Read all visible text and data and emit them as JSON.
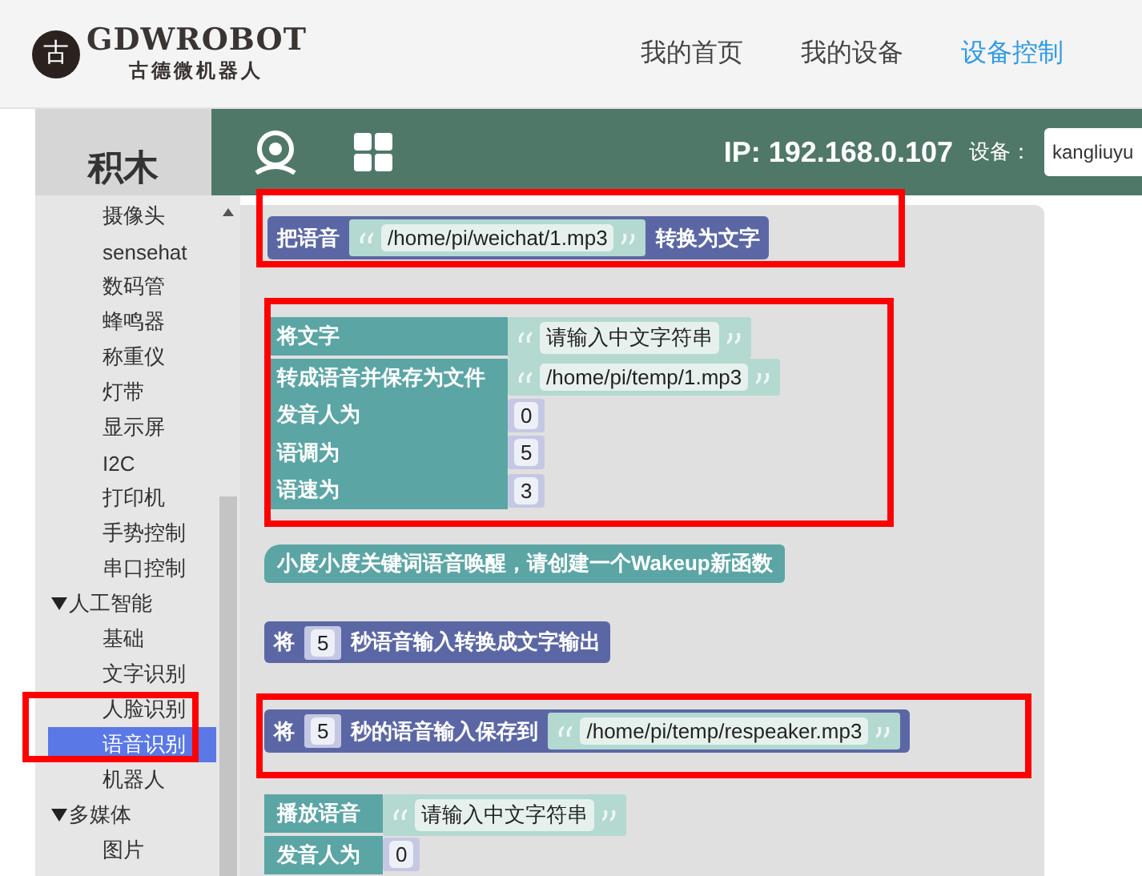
{
  "header": {
    "logo": {
      "mark": "古",
      "title": "GDWROBOT",
      "subtitle": "古德微机器人"
    },
    "nav": [
      {
        "label": "我的首页",
        "selected": false
      },
      {
        "label": "我的设备",
        "selected": false
      },
      {
        "label": "设备控制",
        "selected": true
      }
    ]
  },
  "sidebar": {
    "title": "积木",
    "items": [
      {
        "label": "摄像头",
        "selected": false
      },
      {
        "label": "sensehat",
        "selected": false
      },
      {
        "label": "数码管",
        "selected": false
      },
      {
        "label": "蜂鸣器",
        "selected": false
      },
      {
        "label": "称重仪",
        "selected": false
      },
      {
        "label": "灯带",
        "selected": false
      },
      {
        "label": "显示屏",
        "selected": false
      },
      {
        "label": "I2C",
        "selected": false
      },
      {
        "label": "打印机",
        "selected": false
      },
      {
        "label": "手势控制",
        "selected": false
      },
      {
        "label": "串口控制",
        "selected": false
      },
      {
        "label": "人工智能",
        "selected": false,
        "expanded": true,
        "children": [
          {
            "label": "基础",
            "selected": false
          },
          {
            "label": "文字识别",
            "selected": false
          },
          {
            "label": "人脸识别",
            "selected": false
          },
          {
            "label": "语音识别",
            "selected": true
          },
          {
            "label": "机器人",
            "selected": false
          }
        ]
      },
      {
        "label": "多媒体",
        "selected": false,
        "expanded": true,
        "children": [
          {
            "label": "图片",
            "selected": false
          }
        ]
      }
    ]
  },
  "toolbar": {
    "ip": "IP: 192.168.0.107",
    "device_label": "设备：",
    "device_value": "kangliuyu"
  },
  "blocks": [
    {
      "kind": "inline",
      "parts": [
        {
          "kind": "label",
          "text": "把语音"
        },
        {
          "kind": "string",
          "text": "/home/pi/weichat/1.mp3"
        },
        {
          "kind": "label",
          "text": "转换为文字"
        }
      ]
    },
    {
      "kind": "rows",
      "rows": [
        {
          "label": "将文字",
          "input": {
            "kind": "string",
            "text": "请输入中文字符串"
          }
        },
        {
          "label": "转成语音并保存为文件",
          "input": {
            "kind": "string",
            "text": "/home/pi/temp/1.mp3"
          }
        },
        {
          "label": "发音人为",
          "input": {
            "kind": "number",
            "text": "0"
          }
        },
        {
          "label": "语调为",
          "input": {
            "kind": "number",
            "text": "5"
          }
        },
        {
          "label": "语速为",
          "input": {
            "kind": "number",
            "text": "3"
          }
        }
      ]
    },
    {
      "kind": "event",
      "parts": [
        {
          "kind": "label",
          "text": "小度小度关键词语音唤醒，请创建一个Wakeup新函数"
        }
      ]
    },
    {
      "kind": "inline",
      "parts": [
        {
          "kind": "label",
          "text": "将"
        },
        {
          "kind": "number",
          "text": "5"
        },
        {
          "kind": "label",
          "text": "秒语音输入转换成文字输出"
        }
      ]
    },
    {
      "kind": "inline",
      "parts": [
        {
          "kind": "label",
          "text": "将"
        },
        {
          "kind": "number",
          "text": "5"
        },
        {
          "kind": "label",
          "text": "秒的语音输入保存到"
        },
        {
          "kind": "string",
          "text": "/home/pi/temp/respeaker.mp3"
        }
      ]
    },
    {
      "kind": "rows",
      "rows": [
        {
          "label": "播放语音",
          "input": {
            "kind": "string",
            "text": "请输入中文字符串"
          }
        },
        {
          "label": "发音人为",
          "input": {
            "kind": "number",
            "text": "0"
          }
        }
      ]
    }
  ],
  "highlights": [
    {
      "kind": "frame"
    },
    {
      "kind": "frame"
    },
    {
      "kind": "frame"
    },
    {
      "kind": "frame"
    }
  ]
}
